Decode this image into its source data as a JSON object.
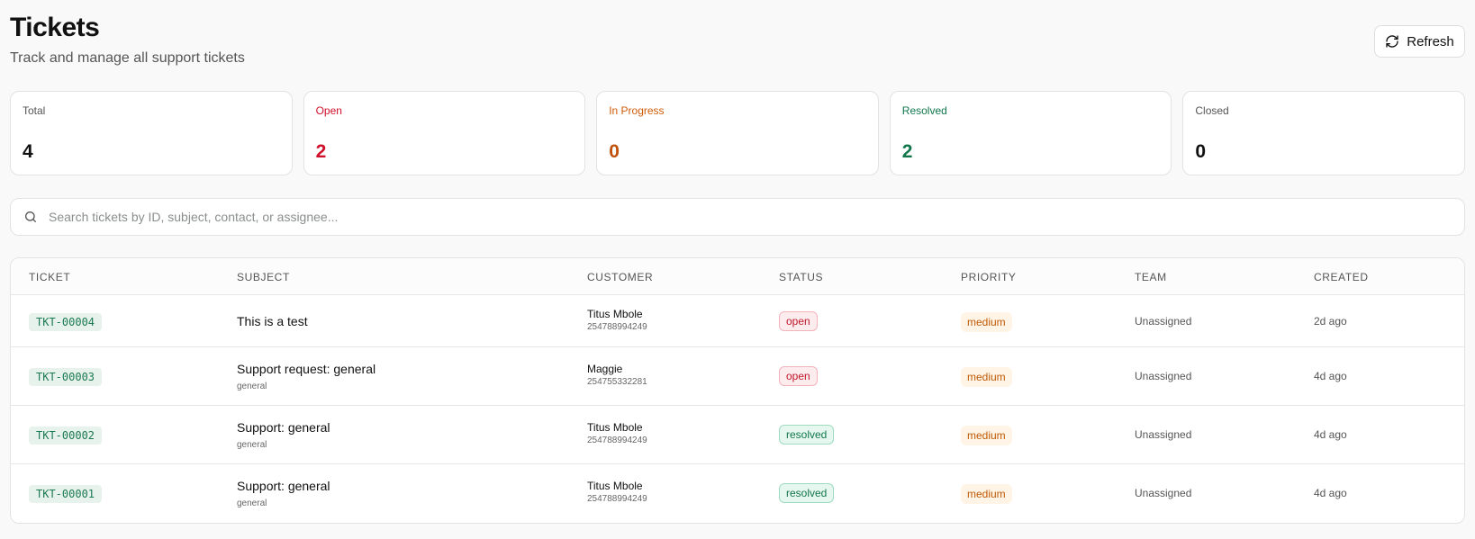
{
  "header": {
    "title": "Tickets",
    "subtitle": "Track and manage all support tickets",
    "refresh_label": "Refresh"
  },
  "stats": [
    {
      "label": "Total",
      "value": "4",
      "color": "#555555",
      "value_color": "#111111"
    },
    {
      "label": "Open",
      "value": "2",
      "color": "#d0102b",
      "value_color": "#d0102b"
    },
    {
      "label": "In Progress",
      "value": "0",
      "color": "#d05a06",
      "value_color": "#c0500a"
    },
    {
      "label": "Resolved",
      "value": "2",
      "color": "#11774a",
      "value_color": "#11774a"
    },
    {
      "label": "Closed",
      "value": "0",
      "color": "#555555",
      "value_color": "#111111"
    }
  ],
  "search": {
    "placeholder": "Search tickets by ID, subject, contact, or assignee..."
  },
  "table": {
    "columns": [
      "TICKET",
      "SUBJECT",
      "CUSTOMER",
      "STATUS",
      "PRIORITY",
      "TEAM",
      "CREATED"
    ],
    "rows": [
      {
        "ticket": "TKT-00004",
        "subject": "This is a test",
        "category": "",
        "customer": "Titus Mbole",
        "phone": "254788994249",
        "status": "open",
        "priority": "medium",
        "team": "Unassigned",
        "created": "2d ago"
      },
      {
        "ticket": "TKT-00003",
        "subject": "Support request: general",
        "category": "general",
        "customer": "Maggie",
        "phone": "254755332281",
        "status": "open",
        "priority": "medium",
        "team": "Unassigned",
        "created": "4d ago"
      },
      {
        "ticket": "TKT-00002",
        "subject": "Support: general",
        "category": "general",
        "customer": "Titus Mbole",
        "phone": "254788994249",
        "status": "resolved",
        "priority": "medium",
        "team": "Unassigned",
        "created": "4d ago"
      },
      {
        "ticket": "TKT-00001",
        "subject": "Support: general",
        "category": "general",
        "customer": "Titus Mbole",
        "phone": "254788994249",
        "status": "resolved",
        "priority": "medium",
        "team": "Unassigned",
        "created": "4d ago"
      }
    ]
  }
}
